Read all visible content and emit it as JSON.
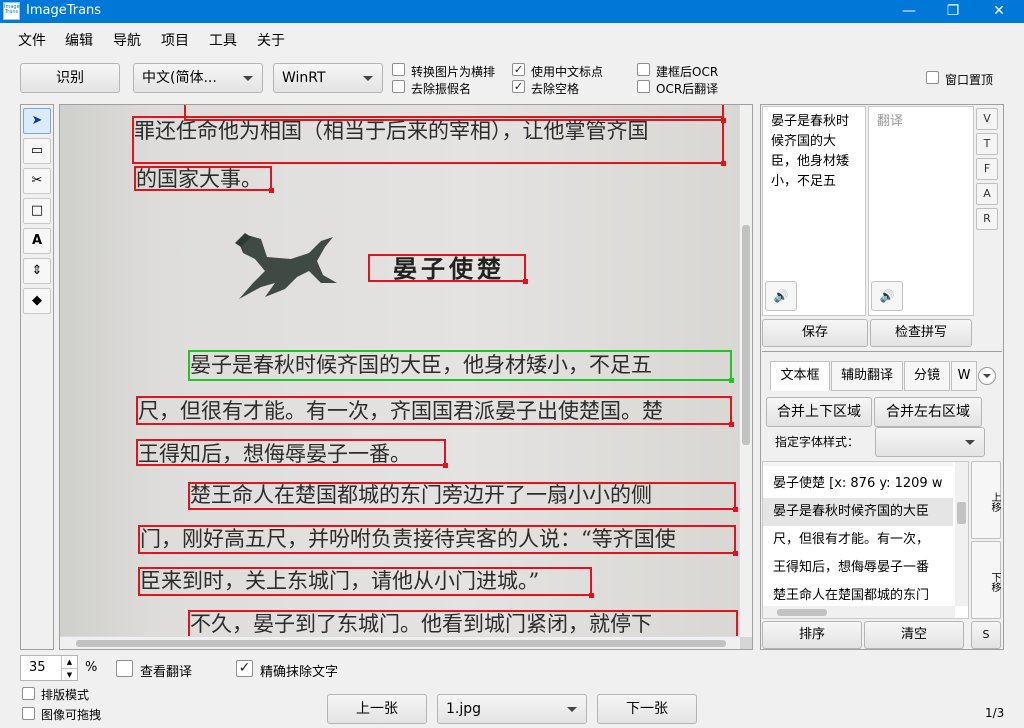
{
  "window": {
    "icon_text": "Image Trans",
    "title": "ImageTrans",
    "controls": [
      "—",
      "❐",
      "✕"
    ]
  },
  "menu": [
    "文件",
    "编辑",
    "导航",
    "项目",
    "工具",
    "关于"
  ],
  "toolbar": {
    "recognize_label": "识别",
    "lang_combo": "中文(简体...",
    "engine_combo": "WinRT",
    "options": [
      {
        "label": "转换图片为横排",
        "checked": false
      },
      {
        "label": "去除振假名",
        "checked": false
      },
      {
        "label": "使用中文标点",
        "checked": true
      },
      {
        "label": "去除空格",
        "checked": true
      },
      {
        "label": "建框后OCR",
        "checked": false
      },
      {
        "label": "OCR后翻译",
        "checked": false
      },
      {
        "label": "窗口置顶",
        "checked": false
      }
    ]
  },
  "tools": [
    "pointer-icon",
    "crop-icon",
    "scissors-icon",
    "rectangle-icon",
    "text-icon",
    "resize-icon",
    "layers-icon"
  ],
  "tool_glyphs": [
    "➤",
    "▭",
    "✂",
    "□",
    "A",
    "⇕",
    "◆"
  ],
  "page_text": [
    "罪还任命他为相国（相当于后来的宰相），让他掌管齐国",
    "的国家大事。",
    "晏子使楚",
    "晏子是春秋时候齐国的大臣，他身材矮小，不足五",
    "尺，但很有才能。有一次，齐国国君派晏子出使楚国。楚",
    "王得知后，想侮辱晏子一番。",
    "楚王命人在楚国都城的东门旁边开了一扇小小的侧",
    "门，刚好高五尺，并吩咐负责接待宾客的人说：“等齐国使",
    "臣来到时，关上东城门，请他从小门进城。”",
    "不久，晏子到了东城门。他看到城门紧闭，就停下"
  ],
  "source_text": "晏子是春秋时候齐国的大臣，他身材矮小，不足五",
  "target_placeholder": "翻译",
  "side_letters": [
    "V",
    "T",
    "F",
    "A",
    "R"
  ],
  "save_label": "保存",
  "spellcheck_label": "检查拼写",
  "tabs": [
    "文本框",
    "辅助翻译",
    "分镜",
    "W"
  ],
  "merge_vertical_label": "合并上下区域",
  "merge_horizontal_label": "合并左右区域",
  "font_style_label": "指定字体样式：",
  "textbox_list": [
    "晏子使楚 [x: 876 y: 1209 w",
    "晏子是春秋时候齐国的大臣",
    "尺，但很有才能。有一次，",
    "王得知后，想侮辱晏子一番",
    "楚王命人在楚国都城的东门"
  ],
  "move_up_label": "上移",
  "move_down_label": "下移",
  "sort_label": "排序",
  "clear_label": "清空",
  "s_label": "S",
  "zoom": {
    "value": "35",
    "unit": "%"
  },
  "bottom_options": [
    {
      "label": "查看翻译",
      "checked": false
    },
    {
      "label": "精确抹除文字",
      "checked": true
    },
    {
      "label": "排版模式",
      "checked": false
    },
    {
      "label": "图像可拖拽",
      "checked": false
    }
  ],
  "prev_label": "上一张",
  "file_combo": "1.jpg",
  "next_label": "下一张",
  "page_indicator": "1/3",
  "accent_color": "#0078d7",
  "box_color": "#e0141c",
  "selected_box_color": "#22c322"
}
